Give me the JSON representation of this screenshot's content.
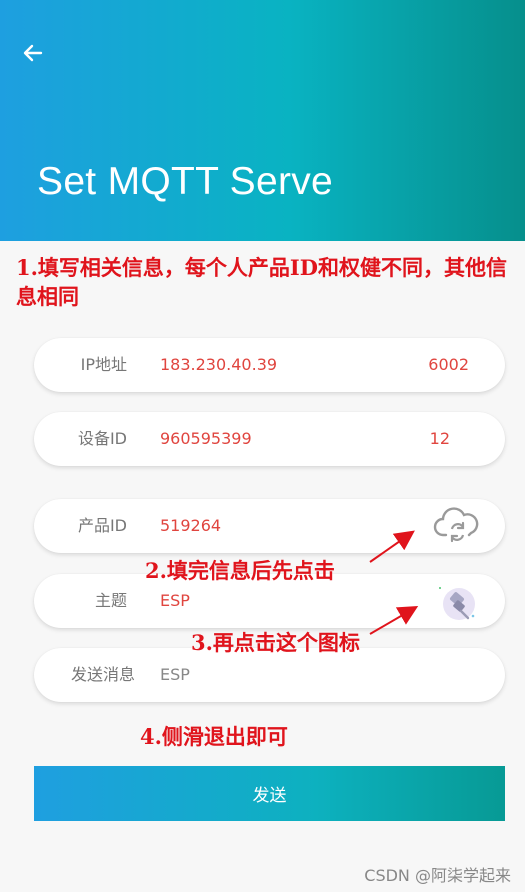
{
  "header": {
    "title": "Set MQTT Serve"
  },
  "annotations": {
    "step1": "1.填写相关信息，每个人产品ID和权健不同，其他信息相同",
    "step2": "2.填完信息后先点击",
    "step3": "3.再点击这个图标",
    "step4": "4.侧滑退出即可"
  },
  "form": {
    "ip": {
      "label": "IP地址",
      "value": "183.230.40.39",
      "port": "6002"
    },
    "device": {
      "label": "设备ID",
      "value": "960595399",
      "extra": "12"
    },
    "product": {
      "label": "产品ID",
      "value": "519264"
    },
    "topic": {
      "label": "主题",
      "value": "ESP"
    },
    "message": {
      "label": "发送消息",
      "value": "ESP"
    }
  },
  "send_button": {
    "label": "发送"
  },
  "watermark": "CSDN @阿柒学起来",
  "colors": {
    "header_start": "#1e9fe0",
    "header_end": "#068f8c",
    "annotation": "#e0141c",
    "value": "#e0453f"
  },
  "icons": [
    "back-arrow-icon",
    "cloud-sync-icon",
    "pin-icon"
  ]
}
